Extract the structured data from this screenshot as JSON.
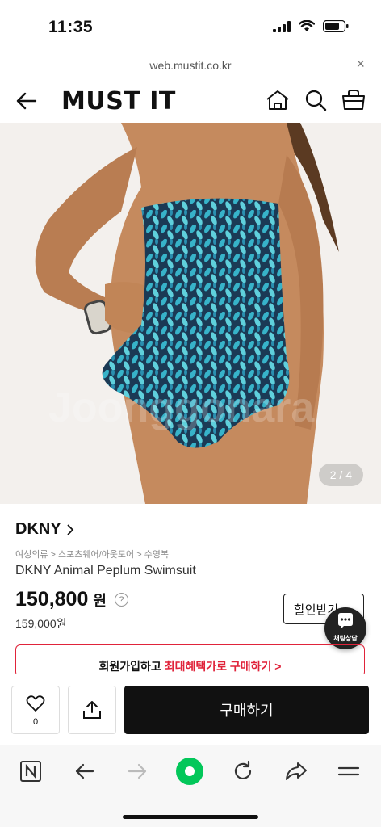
{
  "status": {
    "time": "11:35"
  },
  "browser": {
    "url": "web.mustit.co.kr",
    "close": "×"
  },
  "header": {
    "logo": "MUST IT"
  },
  "image": {
    "counter": "2 / 4",
    "watermark": "Joonggonara"
  },
  "product": {
    "brand": "DKNY",
    "breadcrumb": "여성의류 > 스포츠웨어/아웃도어 > 수영복",
    "title": "DKNY Animal Peplum Swimsuit",
    "price": "150,800",
    "price_unit": "원",
    "price_info": "?",
    "original_price": "159,000원",
    "discount_label": "할인받기",
    "chat_label": "채팅상담",
    "promo_prefix": "회원가입하고 ",
    "promo_highlight": "최대혜택가로 구매하기",
    "promo_arrow": ">"
  },
  "buy_bar": {
    "like_count": "0",
    "buy_label": "구매하기"
  },
  "colors": {
    "accent_red": "#e0233a",
    "buy_button": "#111111",
    "naver_green": "#03c75a",
    "swimsuit": "#1f8ea8"
  }
}
